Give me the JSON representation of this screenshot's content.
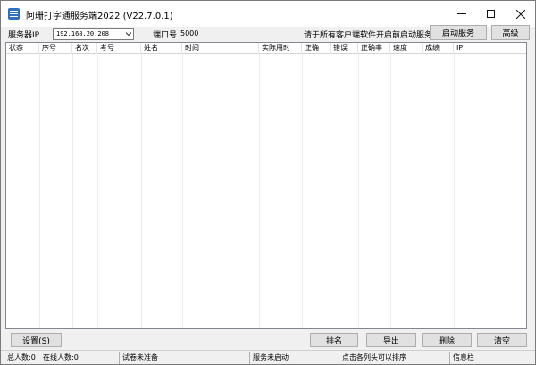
{
  "window": {
    "title": "阿珊打字通服务端2022 (V22.7.0.1)"
  },
  "toolbar": {
    "server_ip_label": "服务器IP",
    "server_ip_value": "192.168.20.208",
    "port_label": "端口号",
    "port_value": "5000",
    "hint": "请于所有客户端软件开启前启动服务",
    "start_label": "启动服务",
    "advanced_label": "高级"
  },
  "table": {
    "columns": [
      "状态",
      "序号",
      "名次",
      "考号",
      "姓名",
      "时间",
      "实际用时",
      "正确",
      "错误",
      "正确率",
      "速度",
      "成绩",
      "IP"
    ]
  },
  "bottom": {
    "settings_label": "设置(S)",
    "rank_label": "排名",
    "export_label": "导出",
    "delete_label": "删除",
    "clear_label": "清空"
  },
  "statusbar": {
    "total_users": "总人数:0",
    "online_users": "在线人数:0",
    "exam_status": "试卷未准备",
    "service_status": "服务未启动",
    "sort_hint": "点击各列头可以排序",
    "info_bar": "信息栏"
  }
}
